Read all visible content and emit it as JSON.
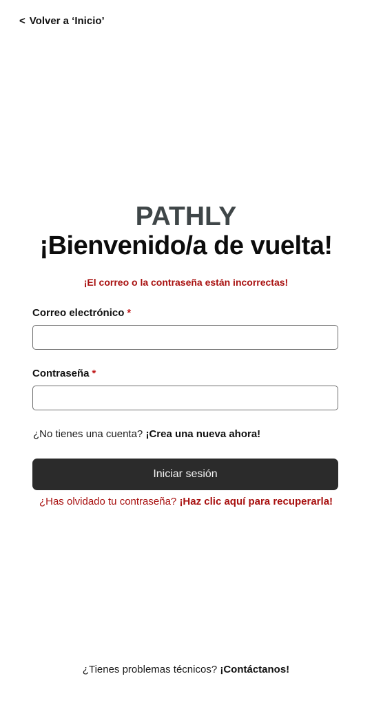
{
  "nav": {
    "back_icon": "chevron-left-icon",
    "back_glyph": "<",
    "back_label": "Volver a ‘Inicio’"
  },
  "brand": {
    "logo_text": "PATHLY",
    "logo_color": "#3f4648"
  },
  "header": {
    "title": "¡Bienvenido/a de vuelta!"
  },
  "alert": {
    "error_message": "¡El correo o la contraseña están incorrectas!",
    "error_color": "#a8100f"
  },
  "form": {
    "email_label": "Correo electrónico",
    "email_value": "",
    "password_label": "Contraseña",
    "password_value": "",
    "required_marker": "*",
    "signup_prompt": "¿No tienes una cuenta?",
    "signup_link": "¡Crea una nueva ahora!",
    "submit_label": "Iniciar sesión",
    "submit_color": "#2b2b2b",
    "forgot_prompt": "¿Has olvidado tu contraseña?",
    "forgot_link": "¡Haz clic aquí para recuperarla!"
  },
  "footer": {
    "support_prompt": "¿Tienes problemas técnicos?",
    "support_link": "¡Contáctanos!"
  }
}
